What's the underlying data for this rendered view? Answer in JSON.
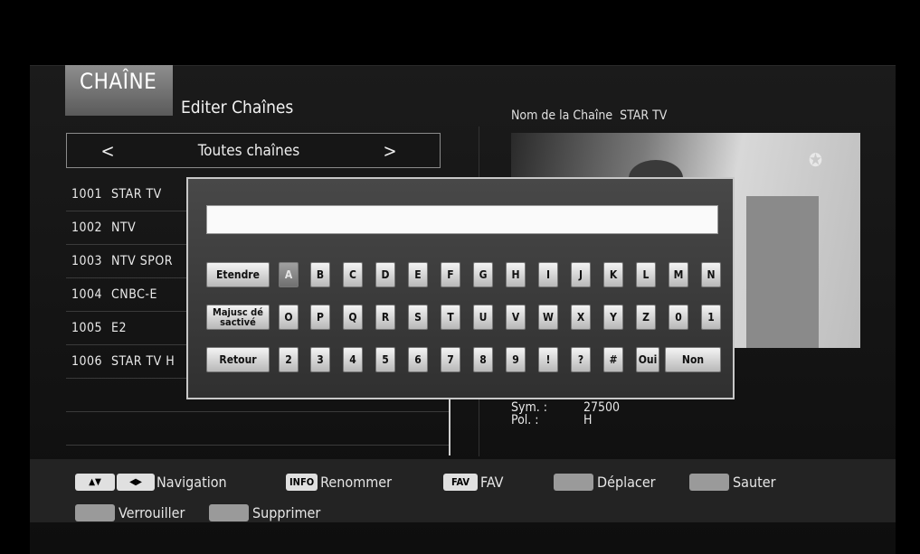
{
  "header": {
    "tab": "CHAÎNE",
    "subtitle": "Editer Chaînes"
  },
  "channel_info": {
    "label": "Nom de la Chaîne",
    "value": "STAR TV",
    "sym_label": "Sym. :",
    "sym_value": "27500",
    "pol_label": "Pol. :",
    "pol_value": "H"
  },
  "list_selector": {
    "left": "<",
    "label": "Toutes chaînes",
    "right": ">"
  },
  "channels": [
    {
      "num": "1001",
      "name": "STAR TV"
    },
    {
      "num": "1002",
      "name": "NTV"
    },
    {
      "num": "1003",
      "name": "NTV SPOR"
    },
    {
      "num": "1004",
      "name": "CNBC-E"
    },
    {
      "num": "1005",
      "name": "E2"
    },
    {
      "num": "1006",
      "name": "STAR TV H"
    }
  ],
  "keyboard": {
    "input_value": "",
    "func": {
      "extend": "Etendre",
      "caps": "Majusc dé sactivé",
      "back": "Retour"
    },
    "row1": [
      "A",
      "B",
      "C",
      "D",
      "E",
      "F",
      "G",
      "H",
      "I",
      "J",
      "K",
      "L",
      "M",
      "N"
    ],
    "row2": [
      "O",
      "P",
      "Q",
      "R",
      "S",
      "T",
      "U",
      "V",
      "W",
      "X",
      "Y",
      "Z",
      "0",
      "1"
    ],
    "row3": [
      "2",
      "3",
      "4",
      "5",
      "6",
      "7",
      "8",
      "9",
      "!",
      "?",
      "#",
      "Oui",
      "Non"
    ],
    "selected": "A"
  },
  "legend": {
    "navigation": "Navigation",
    "info_key": "INFO",
    "rename": "Renommer",
    "fav_key": "FAV",
    "fav": "FAV",
    "move": "Déplacer",
    "skip": "Sauter",
    "lock": "Verrouiller",
    "delete": "Supprimer"
  },
  "preview": {
    "logo_icon": "star-tv-logo-icon"
  }
}
